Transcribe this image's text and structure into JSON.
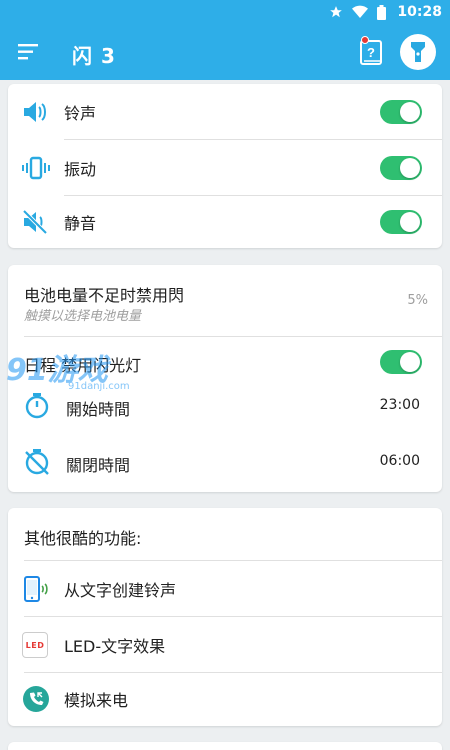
{
  "status_bar": {
    "time": "10:28"
  },
  "app_bar": {
    "title": "闪 3"
  },
  "sound_card": {
    "items": [
      {
        "label": "铃声",
        "toggle_on": true
      },
      {
        "label": "振动",
        "toggle_on": true
      },
      {
        "label": "静音",
        "toggle_on": true
      }
    ]
  },
  "battery_card": {
    "title": "电池电量不足时禁用閃",
    "subtitle": "触摸以选择电池电量",
    "value": "5%",
    "schedule_label": "日程 禁用闪光灯",
    "schedule_on": true,
    "start_label": "開始時間",
    "start_time": "23:00",
    "end_label": "關閉時間",
    "end_time": "06:00"
  },
  "features_card": {
    "header": "其他很酷的功能:",
    "items": [
      {
        "label": "从文字创建铃声"
      },
      {
        "label": "LED-文字效果",
        "icon_text": "LED"
      },
      {
        "label": "模拟来电"
      }
    ]
  },
  "watermark": {
    "text": "91游戏",
    "subtext": "91danji.com"
  },
  "colors": {
    "primary": "#2eaee8",
    "accent_icon": "#29a9e1",
    "toggle_on": "#2fbf71",
    "background": "#eceff1"
  }
}
